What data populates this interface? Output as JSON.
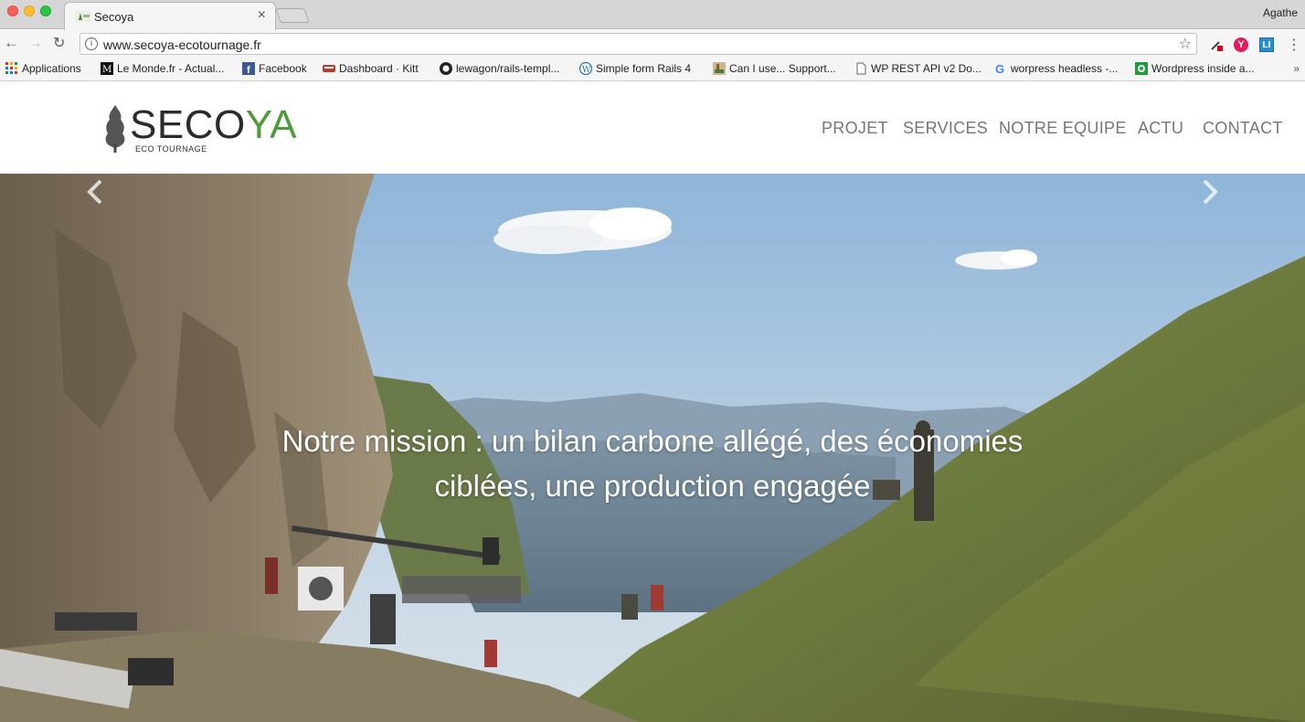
{
  "browser": {
    "tab_title": "Secoya",
    "profile": "Agathe",
    "url": "www.secoya-ecotournage.fr",
    "tab_close": "×",
    "bookmarks": [
      {
        "label": "Applications"
      },
      {
        "label": "Le Monde.fr - Actual..."
      },
      {
        "label": "Facebook"
      },
      {
        "label": "Dashboard · Kitt"
      },
      {
        "label": "lewagon/rails-templ..."
      },
      {
        "label": "Simple form Rails 4"
      },
      {
        "label": "Can I use... Support..."
      },
      {
        "label": "WP REST API v2 Do..."
      },
      {
        "label": "worpress headless -..."
      },
      {
        "label": "Wordpress inside a..."
      }
    ],
    "bookmarks_more": "»"
  },
  "site": {
    "logo": {
      "text_start": "SECO",
      "text_end": "YA",
      "tagline": "ECO TOURNAGE"
    },
    "nav": [
      "PROJET",
      "SERVICES",
      "NOTRE EQUIPE",
      "ACTU",
      "CONTACT"
    ],
    "hero": {
      "caption_line1": "Notre mission : un bilan carbone allégé, des économies",
      "caption_line2": "ciblées, une production engagée"
    }
  },
  "colors": {
    "logo_green": "#4f9a3b",
    "nav_gray": "#767676",
    "sky": "#a9c6df",
    "grass": "#7d8a4a"
  }
}
